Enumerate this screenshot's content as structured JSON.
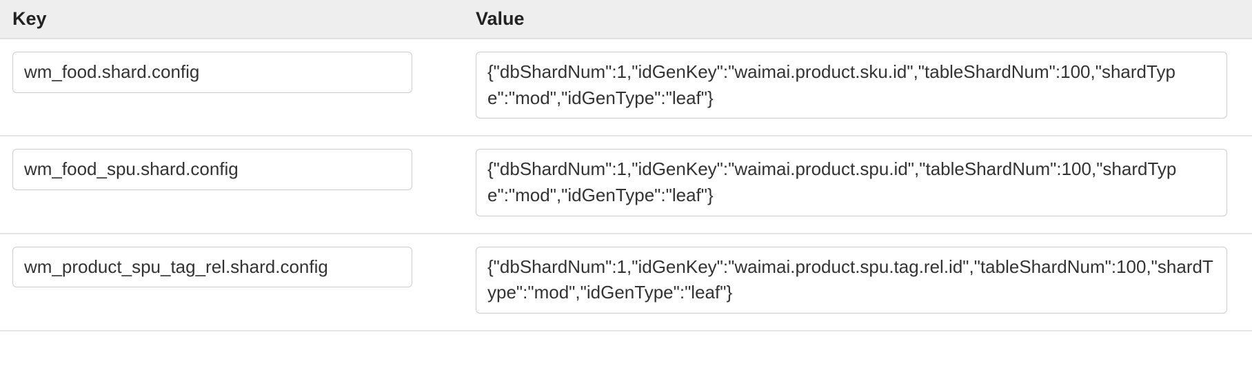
{
  "table": {
    "headers": {
      "key": "Key",
      "value": "Value"
    },
    "rows": [
      {
        "key": "wm_food.shard.config",
        "value": "{\"dbShardNum\":1,\"idGenKey\":\"waimai.product.sku.id\",\"tableShardNum\":100,\"shardType\":\"mod\",\"idGenType\":\"leaf\"}"
      },
      {
        "key": "wm_food_spu.shard.config",
        "value": "{\"dbShardNum\":1,\"idGenKey\":\"waimai.product.spu.id\",\"tableShardNum\":100,\"shardType\":\"mod\",\"idGenType\":\"leaf\"}"
      },
      {
        "key": "wm_product_spu_tag_rel.shard.config",
        "value": "{\"dbShardNum\":1,\"idGenKey\":\"waimai.product.spu.tag.rel.id\",\"tableShardNum\":100,\"shardType\":\"mod\",\"idGenType\":\"leaf\"}"
      }
    ]
  }
}
